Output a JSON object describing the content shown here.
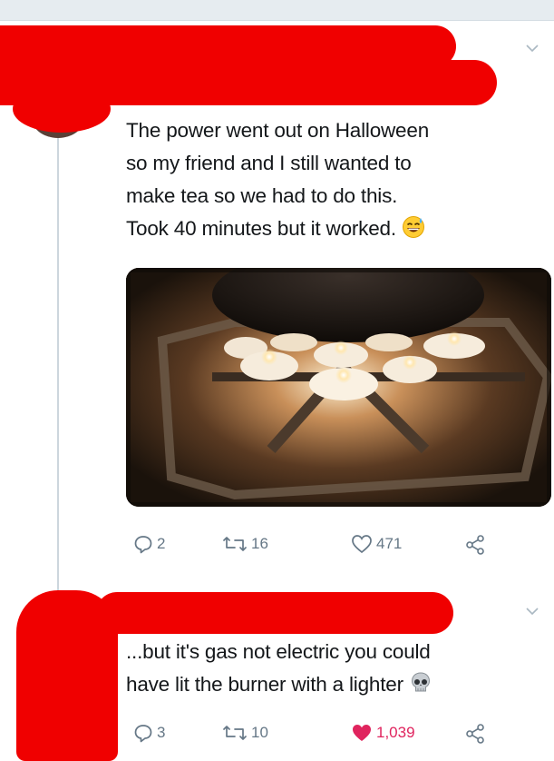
{
  "tweets": [
    {
      "text": "The power went out on Halloween so my friend and I still wanted to make tea so we had to do this. Took 40 minutes but it worked.",
      "text_lines": [
        "The power went out on Halloween",
        "so my friend and I still wanted to",
        "make tea so we had to do this.",
        "Took 40 minutes but it worked."
      ],
      "emoji": "grinning-sweat-emoji",
      "has_photo": true,
      "replies": "2",
      "retweets": "16",
      "likes": "471",
      "liked": false
    },
    {
      "text": "...but it's gas not electric you could have lit the burner with a lighter",
      "text_lines": [
        "...but it's gas not electric you could",
        "have lit the burner with a lighter"
      ],
      "emoji": "skull-emoji",
      "has_photo": false,
      "replies": "3",
      "retweets": "10",
      "likes": "1,039",
      "liked": true
    }
  ],
  "colors": {
    "redaction": "#f00000",
    "action_gray": "#657786",
    "like_red": "#e0245e",
    "text": "#14171a"
  }
}
